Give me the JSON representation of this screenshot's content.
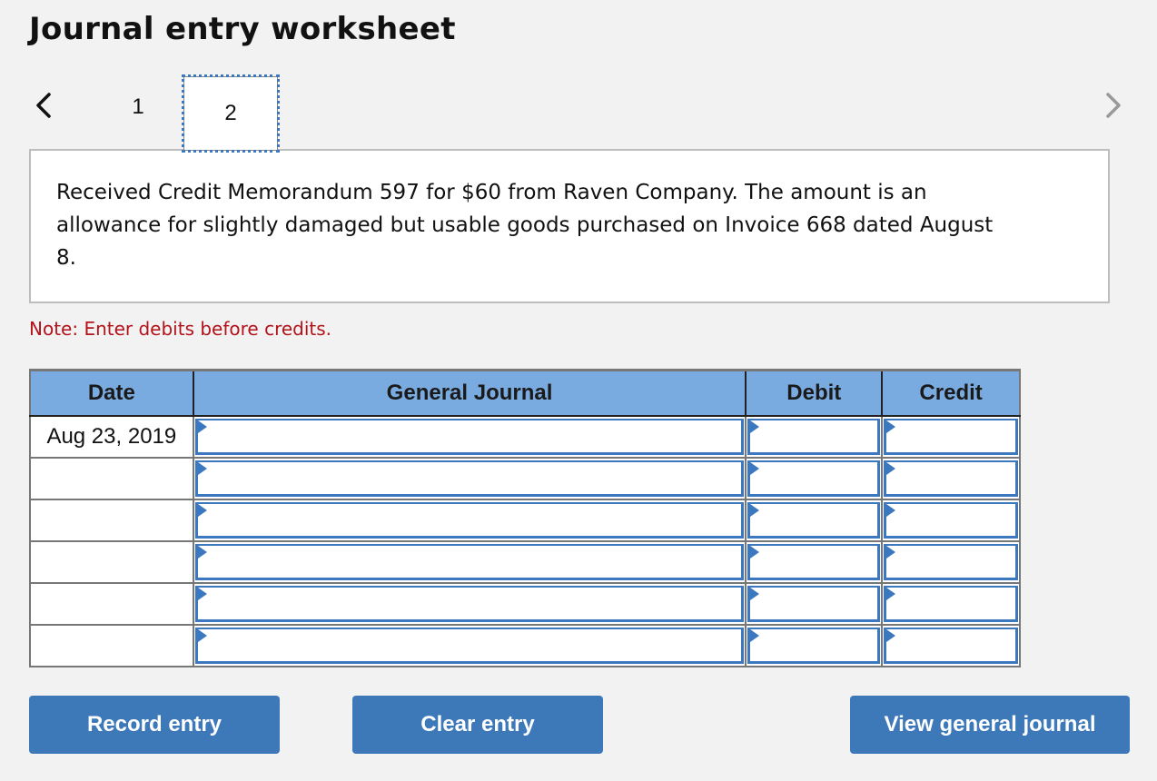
{
  "header": {
    "title": "Journal entry worksheet"
  },
  "pagination": {
    "prev_icon": "chevron-left-icon",
    "next_icon": "chevron-right-icon",
    "pages": [
      "1",
      "2"
    ],
    "current_page": "2"
  },
  "question": {
    "text": "Received Credit Memorandum 597 for $60 from Raven Company. The amount is an allowance for slightly damaged but usable goods purchased on Invoice 668 dated August 8."
  },
  "note": "Note: Enter debits before credits.",
  "table": {
    "columns": [
      "Date",
      "General Journal",
      "Debit",
      "Credit"
    ],
    "rows": [
      {
        "date": "Aug 23, 2019",
        "account": "",
        "debit": "",
        "credit": ""
      },
      {
        "date": "",
        "account": "",
        "debit": "",
        "credit": ""
      },
      {
        "date": "",
        "account": "",
        "debit": "",
        "credit": ""
      },
      {
        "date": "",
        "account": "",
        "debit": "",
        "credit": ""
      },
      {
        "date": "",
        "account": "",
        "debit": "",
        "credit": ""
      },
      {
        "date": "",
        "account": "",
        "debit": "",
        "credit": ""
      }
    ]
  },
  "buttons": {
    "record": "Record entry",
    "clear": "Clear entry",
    "view": "View general journal"
  },
  "colors": {
    "accent": "#3d78b9",
    "header_bg": "#7aabe0",
    "note": "#b3131b",
    "background": "#f2f2f2"
  }
}
